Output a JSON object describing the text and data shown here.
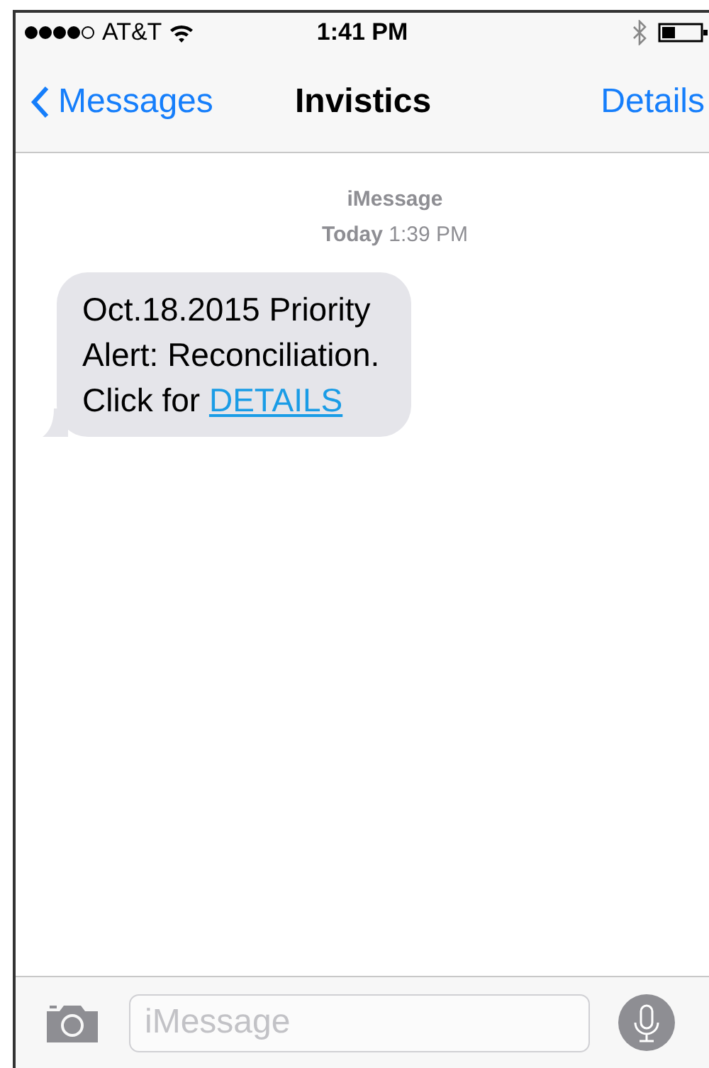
{
  "status_bar": {
    "carrier": "AT&T",
    "time": "1:41 PM"
  },
  "nav_bar": {
    "back": "Messages",
    "title": "Invistics",
    "action": "Details"
  },
  "conversation": {
    "service": "iMessage",
    "day": "Today",
    "time": "1:39 PM",
    "messages": [
      {
        "lines": [
          "Oct.18.2015 Priority",
          "Alert: Reconciliation.",
          "Click for"
        ],
        "link": "DETAILS"
      }
    ]
  },
  "compose_bar": {
    "placeholder": "iMessage"
  }
}
